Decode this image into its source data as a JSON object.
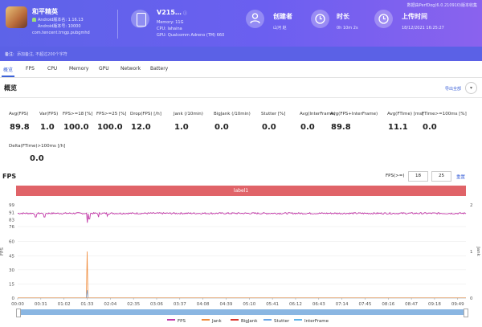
{
  "header": {
    "app_name": "和平精英",
    "android_version_name": "Android版本名: 1.16.13",
    "android_version_code": "Android版本号: 10000",
    "package": "com.tencent.tmgp.pubgmhd",
    "device_name": "V215…",
    "memory": "Memory: 11G",
    "cpu": "CPU: lahaina",
    "gpu": "GPU: Qualcomm Adreno (TM) 660",
    "creator_label": "创建者",
    "creator_value": "山河 赵",
    "duration_label": "时长",
    "duration_value": "0h 10m 2s",
    "upload_label": "上传时间",
    "upload_value": "18/12/2021 16:25:27",
    "tool_version": "数据由PerfDog(6.0.210910)版本收集"
  },
  "note": {
    "label": "备注:",
    "placeholder": "添加备注, 不超过200个字符"
  },
  "tabs": [
    "概览",
    "FPS",
    "CPU",
    "Memory",
    "GPU",
    "Network",
    "Battery"
  ],
  "overview": {
    "title": "概览",
    "export_label": "导出全部",
    "metrics": [
      {
        "label": "Avg(FPS)",
        "value": "89.8"
      },
      {
        "label": "Var(FPS)",
        "value": "1.0"
      },
      {
        "label": "FPS>=18 [%]",
        "value": "100.0"
      },
      {
        "label": "FPS>=25 [%]",
        "value": "100.0"
      },
      {
        "label": "Drop(FPS) [/h]",
        "value": "12.0"
      },
      {
        "label": "Jank (/10min)",
        "value": "1.0"
      },
      {
        "label": "BigJank (/10min)",
        "value": "0.0"
      },
      {
        "label": "Stutter [%]",
        "value": "0.0"
      },
      {
        "label": "Avg(InterFrame)",
        "value": "0.0"
      },
      {
        "label": "Avg(FPS+InterFrame)",
        "value": "89.8"
      },
      {
        "label": "Avg(FTime) [ms]",
        "value": "11.1"
      },
      {
        "label": "FTime>=100ms [%]",
        "value": "0.0"
      },
      {
        "label": "Delta(FTime)>100ms [/h]",
        "value": "0.0"
      }
    ]
  },
  "fps_panel": {
    "title": "FPS",
    "threshold_label": "FPS(>=)",
    "threshold_1": "18",
    "threshold_2": "25",
    "reset_label": "重置",
    "segment_label": "label1",
    "left_axis_label": "FPS",
    "right_axis_label": "Jank"
  },
  "chart_data": {
    "type": "line",
    "x_ticks": [
      "00:00",
      "00:31",
      "01:02",
      "01:33",
      "02:04",
      "02:35",
      "03:06",
      "03:37",
      "04:08",
      "04:39",
      "05:10",
      "05:41",
      "06:12",
      "06:43",
      "07:14",
      "07:45",
      "08:16",
      "08:47",
      "09:18",
      "09:49"
    ],
    "y_left_ticks": [
      "0",
      "15",
      "30",
      "45",
      "60",
      "76",
      "91"
    ],
    "y_left_extra_ticks": [
      "99",
      "91",
      "83"
    ],
    "y_right_ticks": [
      "0",
      "1",
      "2"
    ],
    "ylim_left": [
      0,
      99
    ],
    "ylim_right": [
      0,
      2
    ],
    "series": [
      {
        "name": "FPS",
        "color": "#c23aa8",
        "typical": 90,
        "dips": [
          [
            1.55,
            80
          ],
          [
            1.6,
            84
          ],
          [
            0.4,
            86
          ],
          [
            0.6,
            86
          ],
          [
            1.8,
            86
          ],
          [
            2.0,
            87
          ]
        ]
      },
      {
        "name": "Jank",
        "color": "#f08c3c",
        "spike_x": 1.55,
        "spike_value": 1
      },
      {
        "name": "BigJank",
        "color": "#d9342b"
      },
      {
        "name": "Stutter",
        "color": "#6aa5e6"
      },
      {
        "name": "InterFrame",
        "color": "#5fb3e8"
      }
    ],
    "legend_position": "bottom"
  },
  "colors": {
    "header_bg": "#6a5ff0",
    "accent": "#3c62d8",
    "label_bar": "#e06368"
  }
}
